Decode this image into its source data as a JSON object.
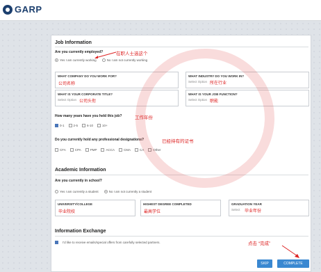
{
  "header": {
    "logo_text": "GARP"
  },
  "job": {
    "section_title": "Job Information",
    "employed_question": "Are you currently employed?",
    "employed_options": [
      "Yes I am currently working",
      "No I am not currently working"
    ],
    "employed_selected": 0,
    "employed_note": "在职人士选这个",
    "company_label": "WHAT COMPANY DO YOU WORK FOR?",
    "company_value": "公司名称",
    "industry_label": "WHAT INDUSTRY DO YOU WORK IN?",
    "industry_placeholder": "Select Option",
    "industry_value": "所在行业",
    "title_label": "WHAT IS YOUR CORPORATE TITLE?",
    "title_placeholder": "Select Option",
    "title_value": "公司头衔",
    "function_label": "WHAT IS YOUR JOB FUNCTION?",
    "function_placeholder": "Select Option",
    "function_value": "职能",
    "years_question": "How many years have you held this job?",
    "years_note": "工作年份",
    "years_options": [
      "0-1",
      "2-5",
      "6-10",
      "10+"
    ],
    "years_selected": 0,
    "designations_question": "Do you currently hold any professional designations?",
    "designations_note": "已经持有的证书",
    "designations": [
      "CFA",
      "CPA",
      "PMP",
      "ACCA",
      "CMA",
      "CA",
      "Other"
    ]
  },
  "academic": {
    "section_title": "Academic Information",
    "school_question": "Are you currently in school?",
    "school_options": [
      "Yes I am currently a student",
      "No I am not currently a student"
    ],
    "school_selected": 1,
    "university_label": "UNIVERSITY/COLLEGE",
    "university_value": "毕业院校",
    "degree_label": "HIGHEST DEGREE COMPLETED",
    "degree_value": "最高学位",
    "grad_label": "GRADUATION YEAR",
    "grad_placeholder": "Select",
    "grad_value": "毕业年份"
  },
  "exchange": {
    "section_title": "Information Exchange",
    "consent_text": "I'd like to receive emails/special offers from carefully selected partners."
  },
  "actions": {
    "note": "点击 “完成”",
    "skip_label": "SKIP",
    "complete_label": "COMPLETE"
  },
  "colors": {
    "accent": "#3a88d1",
    "annotation": "#dd2222",
    "brand": "#1c3f6e"
  }
}
